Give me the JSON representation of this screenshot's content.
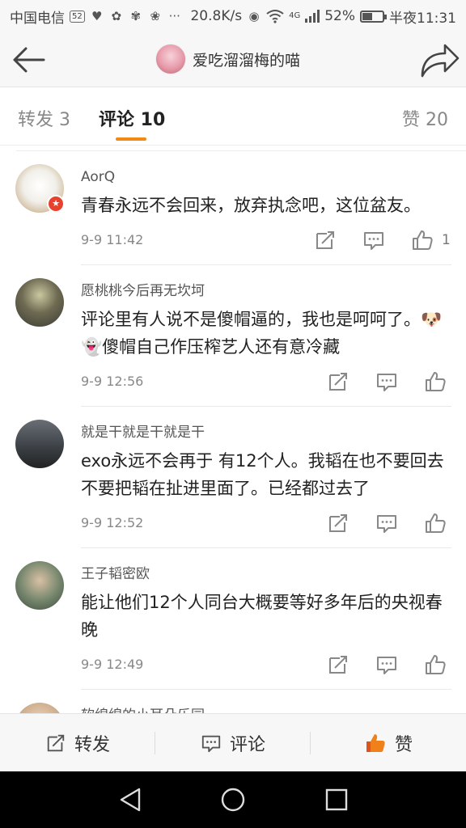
{
  "status": {
    "carrier": "中国电信",
    "sim_badge": "52",
    "speed": "20.8K/s",
    "network": "4G",
    "battery": "52%",
    "battery_level": 0.52,
    "time": "半夜11:31"
  },
  "nav": {
    "title": "爱吃溜溜梅的喵"
  },
  "tabs": [
    {
      "label": "转发 3"
    },
    {
      "label": "评论 10"
    },
    {
      "label": "赞 20"
    }
  ],
  "comments": [
    {
      "name": "AorQ",
      "text": "青春永远不会回来，放弃执念吧，这位盆友。",
      "time": "9-9 11:42",
      "likes": "1"
    },
    {
      "name": "愿桃桃今后再无坎坷",
      "text": "评论里有人说不是傻帽逼的，我也是呵呵了。🐶 👻傻帽自己作压榨艺人还有意冷藏",
      "time": "9-9 12:56",
      "likes": ""
    },
    {
      "name": "就是干就是干就是干",
      "text": "exo永远不会再于 有12个人。我韬在也不要回去不要把韬在扯进里面了。已经都过去了",
      "time": "9-9 12:52",
      "likes": ""
    },
    {
      "name": "王子韬密欧",
      "text": "能让他们12个人同台大概要等好多年后的央视春晚",
      "time": "9-9 12:49",
      "likes": ""
    },
    {
      "name": "软绵绵的小耳朵乐园",
      "text": "",
      "time": "",
      "likes": ""
    }
  ],
  "bottom": {
    "repost": "转发",
    "comment": "评论",
    "like": "赞"
  },
  "colors": {
    "accent": "#f08a14",
    "like_orange": "#f0811a",
    "badge_red": "#e8412c"
  }
}
